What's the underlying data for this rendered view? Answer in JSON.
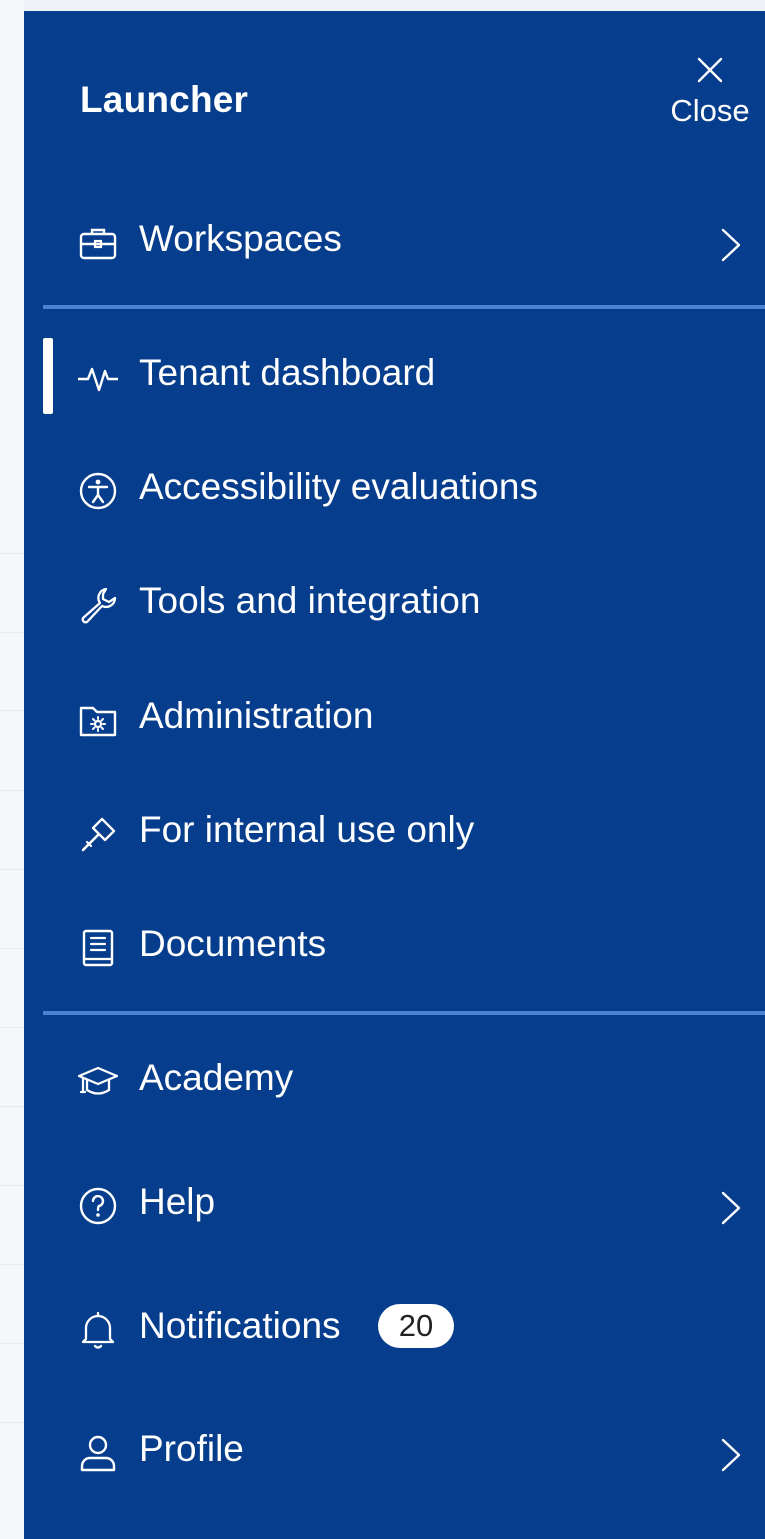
{
  "launcher": {
    "title": "Launcher",
    "close_label": "Close",
    "items": [
      {
        "label": "Workspaces",
        "icon": "briefcase-icon"
      },
      {
        "label": "Tenant dashboard",
        "icon": "pulse-icon",
        "active": true
      },
      {
        "label": "Accessibility evaluations",
        "icon": "accessibility-icon"
      },
      {
        "label": "Tools and integration",
        "icon": "wrench-icon"
      },
      {
        "label": "Administration",
        "icon": "folder-gear-icon"
      },
      {
        "label": "For internal use only",
        "icon": "gavel-icon"
      },
      {
        "label": "Documents",
        "icon": "book-icon"
      },
      {
        "label": "Academy",
        "icon": "graduation-cap-icon"
      },
      {
        "label": "Help",
        "icon": "help-circle-icon"
      },
      {
        "label": "Notifications",
        "icon": "bell-icon",
        "badge": "20"
      },
      {
        "label": "Profile",
        "icon": "user-icon"
      }
    ]
  },
  "colors": {
    "panel_background": "#063d8c",
    "divider": "#4a83d3",
    "text": "#ffffff",
    "badge_background": "#ffffff",
    "badge_text": "#222222"
  }
}
